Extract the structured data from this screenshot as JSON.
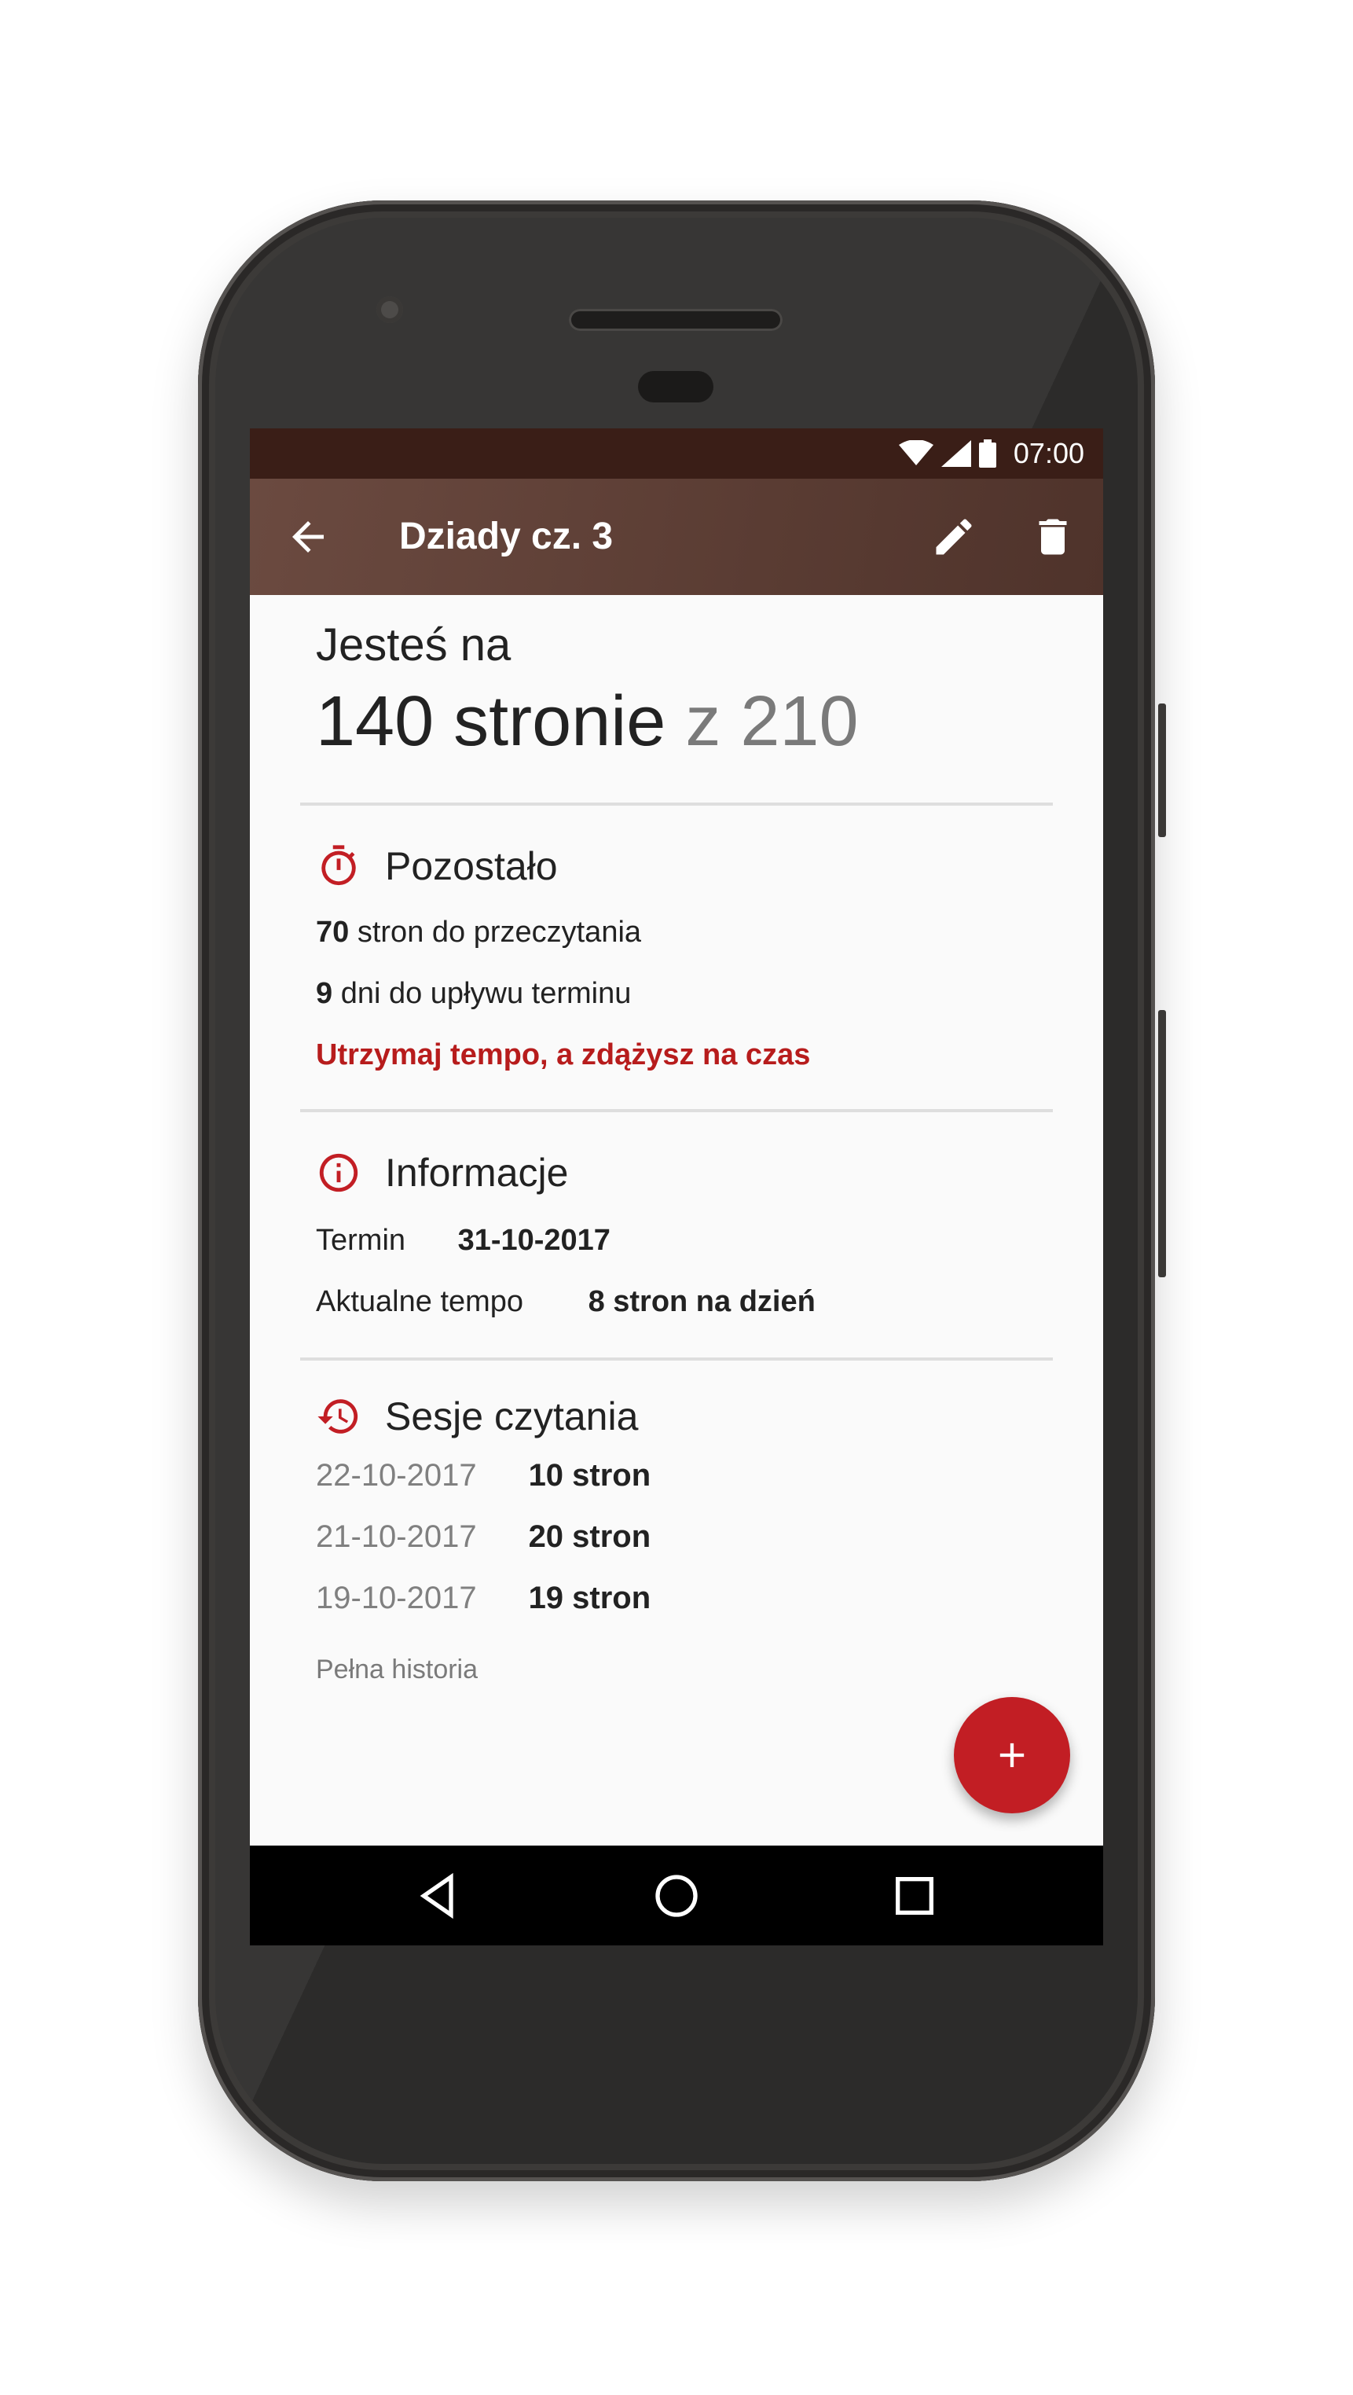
{
  "status_bar": {
    "time": "07:00"
  },
  "app_bar": {
    "title": "Dziady cz. 3"
  },
  "progress": {
    "prefix": "Jesteś na",
    "current_label": "140 stronie",
    "total_label": "z 210",
    "current_page": 140,
    "total_pages": 210
  },
  "remaining": {
    "title": "Pozostało",
    "pages_value": "70",
    "pages_text": "stron do przeczytania",
    "days_value": "9",
    "days_text": "dni do upływu terminu",
    "message": "Utrzymaj tempo, a zdążysz na czas"
  },
  "info": {
    "title": "Informacje",
    "deadline_label": "Termin",
    "deadline_value": "31-10-2017",
    "pace_label": "Aktualne tempo",
    "pace_value": "8 stron na dzień"
  },
  "sessions": {
    "title": "Sesje czytania",
    "items": [
      {
        "date": "22-10-2017",
        "pages": "10 stron"
      },
      {
        "date": "21-10-2017",
        "pages": "20 stron"
      },
      {
        "date": "19-10-2017",
        "pages": "19 stron"
      }
    ],
    "history_link": "Pełna historia"
  },
  "colors": {
    "accent": "#c21e24",
    "warning_text": "#b71c1c",
    "app_bar": "#5a3c33",
    "status_bar": "#3a1e17"
  },
  "icons": {
    "back": "arrow-back-icon",
    "edit": "pencil-icon",
    "delete": "trash-icon",
    "remaining": "timer-icon",
    "info": "info-icon",
    "sessions": "history-icon",
    "fab": "plus-icon",
    "nav": [
      "back-triangle-icon",
      "home-circle-icon",
      "recents-square-icon"
    ]
  }
}
